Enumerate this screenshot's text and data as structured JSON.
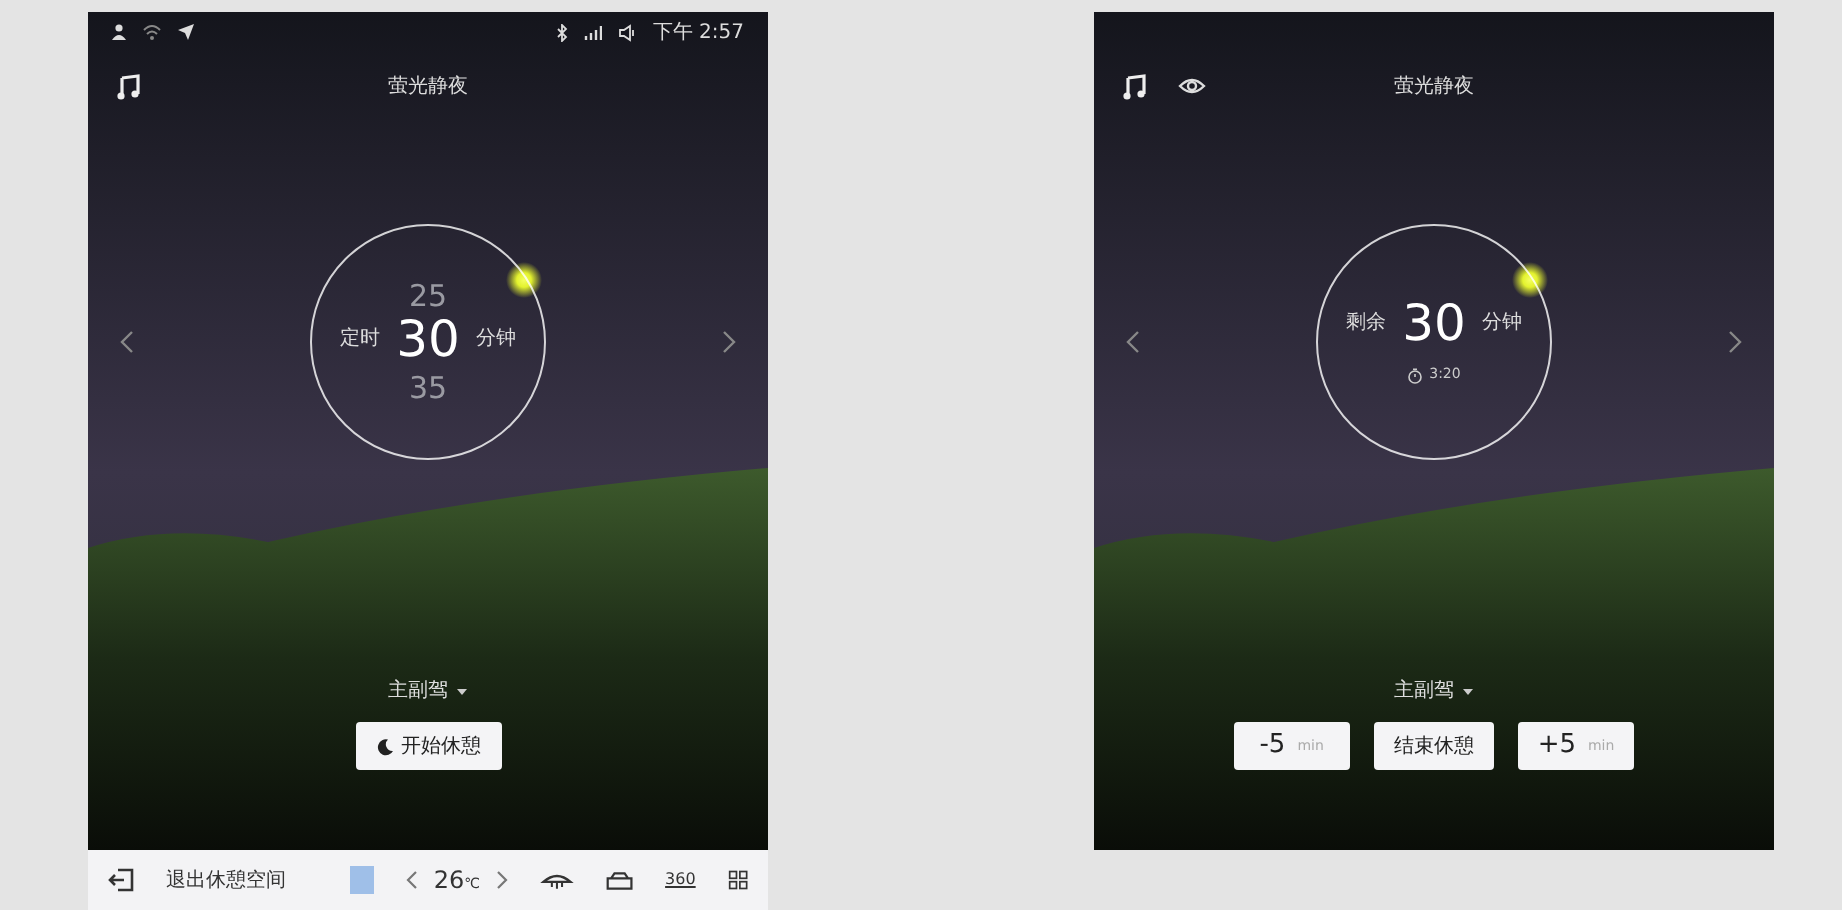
{
  "screens": [
    {
      "kind": "setup",
      "status_bar": {
        "time": "下午 2:57"
      },
      "title": "萤光静夜",
      "timer": {
        "label": "定时",
        "above": "25",
        "value": "30",
        "below": "35",
        "unit": "分钟"
      },
      "seat": "主副驾",
      "actions": [
        {
          "label": "开始休憩"
        }
      ],
      "dock": {
        "exit_label": "退出休憩空间",
        "temperature": "26",
        "temperature_unit": "℃",
        "view_label": "360"
      }
    },
    {
      "kind": "running",
      "title": "萤光静夜",
      "timer": {
        "label": "剩余",
        "value": "30",
        "unit": "分钟",
        "clock": "3:20"
      },
      "seat": "主副驾",
      "actions": [
        {
          "label": "-5",
          "suffix": "min"
        },
        {
          "label": "结束休憩"
        },
        {
          "label": "+5",
          "suffix": "min"
        }
      ]
    }
  ]
}
